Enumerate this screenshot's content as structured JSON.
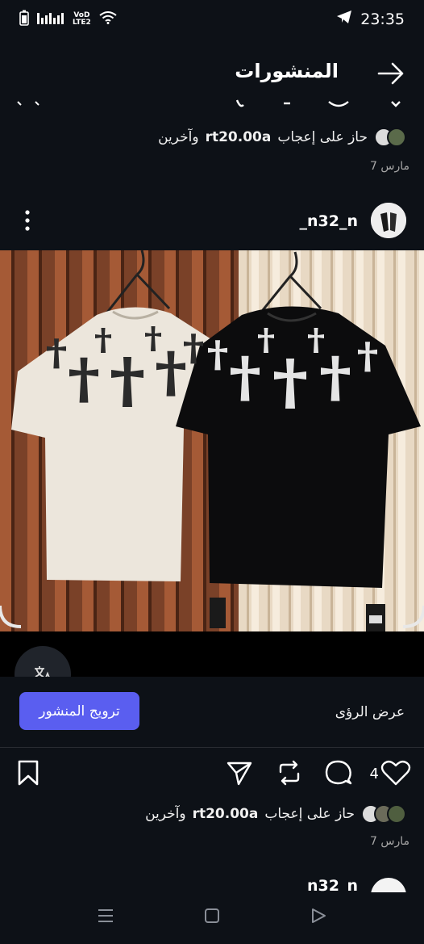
{
  "status_bar": {
    "time": "23:35",
    "network_tag_top": "VoD",
    "network_tag_bottom": "LTE2",
    "icons": [
      "battery-icon",
      "signal-bars-icon",
      "wifi-icon",
      "telegram-icon"
    ]
  },
  "header": {
    "title": "المنشورات",
    "back_icon": "arrow-right-icon"
  },
  "previous_post": {
    "likes_prefix": "حاز على إعجاب",
    "liker": "rt20.00a",
    "likes_suffix": "وآخرين",
    "date": "7 مارس"
  },
  "post": {
    "username": "_n32_n",
    "menu_icon": "kebab-menu-icon",
    "image_description_icon": "translate-icon",
    "promote_button": "ترويج المنشور",
    "insights_link": "عرض الرؤى",
    "like_count": "4",
    "likes_prefix": "حاز على إعجاب",
    "liker": "rt20.00a",
    "likes_suffix": "وآخرين",
    "date": "7 مارس",
    "actions": [
      "heart-icon",
      "comment-icon",
      "repost-icon",
      "share-icon",
      "bookmark-icon"
    ]
  },
  "next_post": {
    "username": "_n32_n"
  },
  "nav": [
    "recents-icon",
    "home-square-icon",
    "back-triangle-icon"
  ],
  "colors": {
    "background": "#0d1117",
    "accent": "#5a5ef0"
  }
}
